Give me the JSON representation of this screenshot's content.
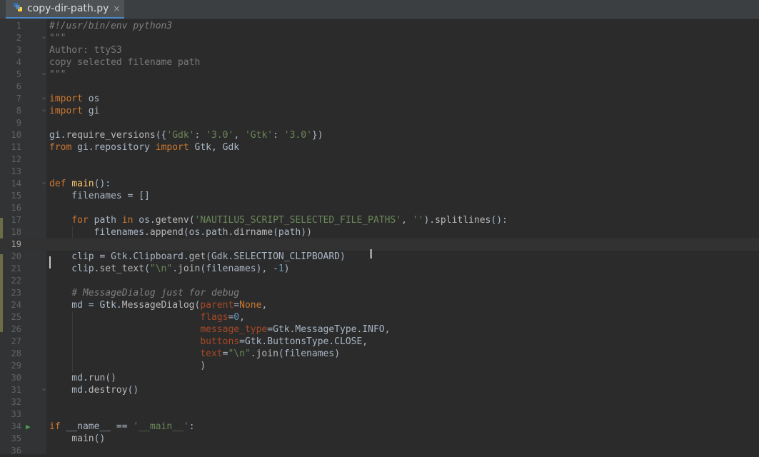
{
  "tab": {
    "filename": "copy-dir-path.py",
    "close_glyph": "×"
  },
  "editor": {
    "current_line": 19,
    "lines": [
      {
        "n": "1",
        "tokens": [
          {
            "t": "#!/usr/bin/env python3",
            "c": "shb"
          }
        ]
      },
      {
        "n": "2",
        "tokens": [
          {
            "t": "\"\"\"",
            "c": "mute"
          }
        ]
      },
      {
        "n": "3",
        "tokens": [
          {
            "t": "Author: ttyS3",
            "c": "mute"
          }
        ]
      },
      {
        "n": "4",
        "tokens": [
          {
            "t": "copy selected filename path",
            "c": "mute"
          }
        ]
      },
      {
        "n": "5",
        "tokens": [
          {
            "t": "\"\"\"",
            "c": "mute"
          }
        ]
      },
      {
        "n": "6",
        "tokens": []
      },
      {
        "n": "7",
        "tokens": [
          {
            "t": "import",
            "c": "kw"
          },
          {
            "t": " os",
            "c": ""
          }
        ]
      },
      {
        "n": "8",
        "tokens": [
          {
            "t": "import",
            "c": "kw"
          },
          {
            "t": " gi",
            "c": ""
          }
        ]
      },
      {
        "n": "9",
        "tokens": []
      },
      {
        "n": "10",
        "tokens": [
          {
            "t": "gi.",
            "c": ""
          },
          {
            "t": "require_versions",
            "c": "call"
          },
          {
            "t": "({",
            "c": ""
          },
          {
            "t": "'Gdk'",
            "c": "str"
          },
          {
            "t": ": ",
            "c": ""
          },
          {
            "t": "'3.0'",
            "c": "str"
          },
          {
            "t": ", ",
            "c": ""
          },
          {
            "t": "'Gtk'",
            "c": "str"
          },
          {
            "t": ": ",
            "c": ""
          },
          {
            "t": "'3.0'",
            "c": "str"
          },
          {
            "t": "})",
            "c": ""
          }
        ]
      },
      {
        "n": "11",
        "tokens": [
          {
            "t": "from",
            "c": "kw"
          },
          {
            "t": " gi.repository ",
            "c": ""
          },
          {
            "t": "import",
            "c": "kw"
          },
          {
            "t": " Gtk, Gdk",
            "c": ""
          }
        ]
      },
      {
        "n": "12",
        "tokens": []
      },
      {
        "n": "13",
        "tokens": []
      },
      {
        "n": "14",
        "tokens": [
          {
            "t": "def",
            "c": "kw"
          },
          {
            "t": " ",
            "c": ""
          },
          {
            "t": "main",
            "c": "fn"
          },
          {
            "t": "():",
            "c": ""
          }
        ]
      },
      {
        "n": "15",
        "tokens": [
          {
            "t": "    filenames = []",
            "c": ""
          }
        ]
      },
      {
        "n": "16",
        "tokens": []
      },
      {
        "n": "17",
        "tokens": [
          {
            "t": "    ",
            "c": ""
          },
          {
            "t": "for",
            "c": "kw"
          },
          {
            "t": " path ",
            "c": ""
          },
          {
            "t": "in",
            "c": "kw"
          },
          {
            "t": " os.",
            "c": ""
          },
          {
            "t": "getenv",
            "c": "call"
          },
          {
            "t": "(",
            "c": ""
          },
          {
            "t": "'NAUTILUS_SCRIPT_SELECTED_FILE_PATHS'",
            "c": "str"
          },
          {
            "t": ", ",
            "c": ""
          },
          {
            "t": "''",
            "c": "str"
          },
          {
            "t": ").",
            "c": ""
          },
          {
            "t": "splitlines",
            "c": "call"
          },
          {
            "t": "():",
            "c": ""
          }
        ]
      },
      {
        "n": "18",
        "tokens": [
          {
            "t": "        filenames.",
            "c": ""
          },
          {
            "t": "append",
            "c": "call"
          },
          {
            "t": "(os.path.",
            "c": ""
          },
          {
            "t": "dirname",
            "c": "call"
          },
          {
            "t": "(path))",
            "c": ""
          }
        ]
      },
      {
        "n": "19",
        "tokens": []
      },
      {
        "n": "20",
        "tokens": [
          {
            "t": "    clip = Gtk.Clipboard.",
            "c": ""
          },
          {
            "t": "get",
            "c": "call"
          },
          {
            "t": "(Gdk.SELECTION_CLIPBOARD)",
            "c": ""
          }
        ]
      },
      {
        "n": "21",
        "tokens": [
          {
            "t": "    clip.",
            "c": ""
          },
          {
            "t": "set_text",
            "c": "call"
          },
          {
            "t": "(",
            "c": ""
          },
          {
            "t": "\"\\n\"",
            "c": "str"
          },
          {
            "t": ".",
            "c": ""
          },
          {
            "t": "join",
            "c": "call"
          },
          {
            "t": "(filenames), -",
            "c": ""
          },
          {
            "t": "1",
            "c": "num"
          },
          {
            "t": ")",
            "c": ""
          }
        ]
      },
      {
        "n": "22",
        "tokens": []
      },
      {
        "n": "23",
        "tokens": [
          {
            "t": "    ",
            "c": ""
          },
          {
            "t": "# MessageDialog just for debug",
            "c": "cmt"
          }
        ]
      },
      {
        "n": "24",
        "tokens": [
          {
            "t": "    md = Gtk.",
            "c": ""
          },
          {
            "t": "MessageDialog",
            "c": "call"
          },
          {
            "t": "(",
            "c": ""
          },
          {
            "t": "parent",
            "c": "par"
          },
          {
            "t": "=",
            "c": ""
          },
          {
            "t": "None",
            "c": "kw"
          },
          {
            "t": ",",
            "c": ""
          }
        ]
      },
      {
        "n": "25",
        "tokens": [
          {
            "t": "                           ",
            "c": ""
          },
          {
            "t": "flags",
            "c": "par"
          },
          {
            "t": "=",
            "c": ""
          },
          {
            "t": "0",
            "c": "num"
          },
          {
            "t": ",",
            "c": ""
          }
        ]
      },
      {
        "n": "26",
        "tokens": [
          {
            "t": "                           ",
            "c": ""
          },
          {
            "t": "message_type",
            "c": "par"
          },
          {
            "t": "=Gtk.MessageType.INFO,",
            "c": ""
          }
        ]
      },
      {
        "n": "27",
        "tokens": [
          {
            "t": "                           ",
            "c": ""
          },
          {
            "t": "buttons",
            "c": "par"
          },
          {
            "t": "=Gtk.ButtonsType.CLOSE,",
            "c": ""
          }
        ]
      },
      {
        "n": "28",
        "tokens": [
          {
            "t": "                           ",
            "c": ""
          },
          {
            "t": "text",
            "c": "par"
          },
          {
            "t": "=",
            "c": ""
          },
          {
            "t": "\"\\n\"",
            "c": "str"
          },
          {
            "t": ".",
            "c": ""
          },
          {
            "t": "join",
            "c": "call"
          },
          {
            "t": "(filenames)",
            "c": ""
          }
        ]
      },
      {
        "n": "29",
        "tokens": [
          {
            "t": "                           )",
            "c": ""
          }
        ]
      },
      {
        "n": "30",
        "tokens": [
          {
            "t": "    md.",
            "c": ""
          },
          {
            "t": "run",
            "c": "call"
          },
          {
            "t": "()",
            "c": ""
          }
        ]
      },
      {
        "n": "31",
        "tokens": [
          {
            "t": "    md.",
            "c": ""
          },
          {
            "t": "destroy",
            "c": "call"
          },
          {
            "t": "()",
            "c": ""
          }
        ]
      },
      {
        "n": "32",
        "tokens": []
      },
      {
        "n": "33",
        "tokens": []
      },
      {
        "n": "34",
        "tokens": [
          {
            "t": "if",
            "c": "kw"
          },
          {
            "t": " __name__ == ",
            "c": ""
          },
          {
            "t": "'__main__'",
            "c": "str"
          },
          {
            "t": ":",
            "c": ""
          }
        ]
      },
      {
        "n": "35",
        "tokens": [
          {
            "t": "    ",
            "c": ""
          },
          {
            "t": "main",
            "c": "call"
          },
          {
            "t": "()",
            "c": ""
          }
        ]
      },
      {
        "n": "36",
        "tokens": []
      }
    ]
  },
  "colors": {
    "background": "#2b2b2b",
    "gutter": "#313335",
    "keyword": "#cc7832",
    "string": "#6a8759",
    "number": "#6897bb",
    "function_def": "#ffc66d",
    "param": "#aa4926"
  },
  "icons": {
    "file": "python-file-icon",
    "run": "run-gutter-icon",
    "fold": "fold-marker-icon",
    "cursor": "text-cursor-icon"
  }
}
